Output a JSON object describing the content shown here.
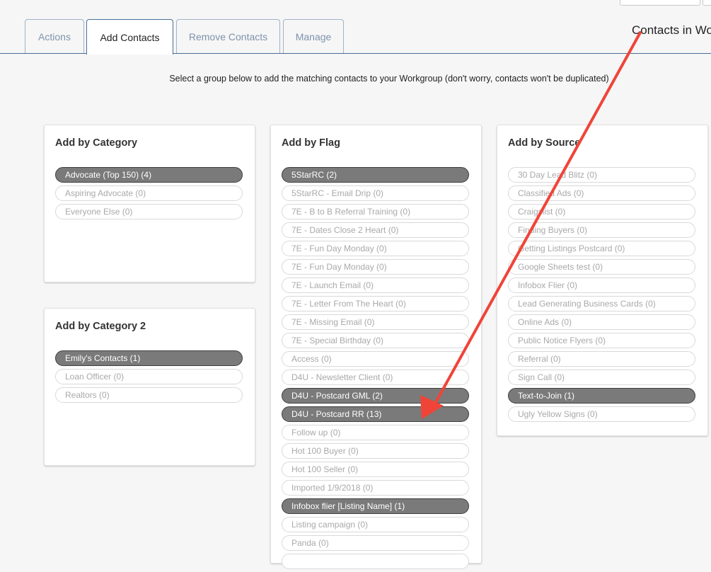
{
  "tabs": [
    "Actions",
    "Add Contacts",
    "Remove Contacts",
    "Manage"
  ],
  "active_tab": "Add Contacts",
  "contacts_in_label": "Contacts in Wo",
  "instruction": "Select a group below to add the matching contacts to your Workgroup (don't worry, contacts won't be duplicated)",
  "panels": {
    "category": {
      "title": "Add by Category",
      "items": [
        {
          "label": "Advocate (Top 150) (4)",
          "selected": true
        },
        {
          "label": "Aspiring Advocate (0)",
          "selected": false
        },
        {
          "label": "Everyone Else (0)",
          "selected": false
        }
      ]
    },
    "category2": {
      "title": "Add by Category 2",
      "items": [
        {
          "label": "Emily's Contacts (1)",
          "selected": true
        },
        {
          "label": "Loan Officer (0)",
          "selected": false
        },
        {
          "label": "Realtors (0)",
          "selected": false
        }
      ]
    },
    "flag": {
      "title": "Add by Flag",
      "items": [
        {
          "label": "5StarRC (2)",
          "selected": true
        },
        {
          "label": "5StarRC - Email Drip (0)",
          "selected": false
        },
        {
          "label": "7E - B to B Referral Training (0)",
          "selected": false
        },
        {
          "label": "7E - Dates Close 2 Heart (0)",
          "selected": false
        },
        {
          "label": "7E - Fun Day Monday (0)",
          "selected": false
        },
        {
          "label": "7E - Fun Day Monday (0)",
          "selected": false
        },
        {
          "label": "7E - Launch Email (0)",
          "selected": false
        },
        {
          "label": "7E - Letter From The Heart (0)",
          "selected": false
        },
        {
          "label": "7E - Missing Email (0)",
          "selected": false
        },
        {
          "label": "7E - Special Birthday (0)",
          "selected": false
        },
        {
          "label": "Access (0)",
          "selected": false
        },
        {
          "label": "D4U - Newsletter Client (0)",
          "selected": false
        },
        {
          "label": "D4U - Postcard GML (2)",
          "selected": true
        },
        {
          "label": "D4U - Postcard RR (13)",
          "selected": true
        },
        {
          "label": "Follow up (0)",
          "selected": false
        },
        {
          "label": "Hot 100 Buyer (0)",
          "selected": false
        },
        {
          "label": "Hot 100 Seller (0)",
          "selected": false
        },
        {
          "label": "Imported 1/9/2018 (0)",
          "selected": false
        },
        {
          "label": "Infobox flier [Listing Name] (1)",
          "selected": true
        },
        {
          "label": "Listing campaign (0)",
          "selected": false
        },
        {
          "label": "Panda (0)",
          "selected": false
        },
        {
          "label": "",
          "selected": false
        }
      ]
    },
    "source": {
      "title": "Add by Source",
      "items": [
        {
          "label": "30 Day Lead Blitz (0)",
          "selected": false
        },
        {
          "label": "Classified Ads (0)",
          "selected": false
        },
        {
          "label": "Craigslist (0)",
          "selected": false
        },
        {
          "label": "Finding Buyers (0)",
          "selected": false
        },
        {
          "label": "Getting Listings Postcard (0)",
          "selected": false
        },
        {
          "label": "Google Sheets test (0)",
          "selected": false
        },
        {
          "label": "Infobox Flier (0)",
          "selected": false
        },
        {
          "label": "Lead Generating Business Cards (0)",
          "selected": false
        },
        {
          "label": "Online Ads (0)",
          "selected": false
        },
        {
          "label": "Public Notice Flyers (0)",
          "selected": false
        },
        {
          "label": "Referral (0)",
          "selected": false
        },
        {
          "label": "Sign Call (0)",
          "selected": false
        },
        {
          "label": "Text-to-Join (1)",
          "selected": true
        },
        {
          "label": "Ugly Yellow Signs (0)",
          "selected": false
        }
      ]
    }
  },
  "annotation": {
    "color": "#f04438",
    "icon": "arrow-annotation"
  }
}
